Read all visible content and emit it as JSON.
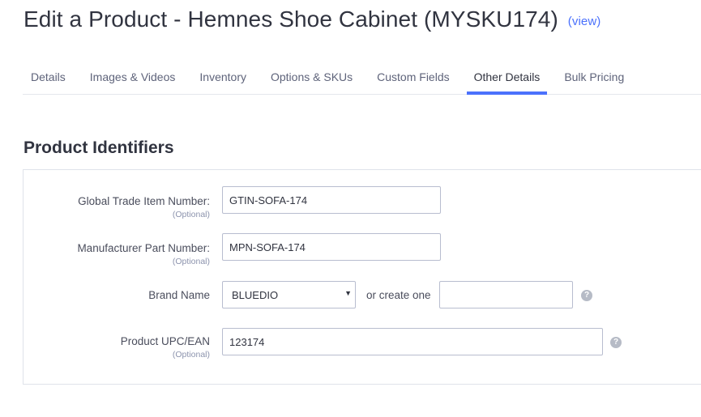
{
  "header": {
    "title": "Edit a Product - Hemnes Shoe Cabinet (MYSKU174)",
    "view_link": "(view)"
  },
  "tabs": [
    {
      "label": "Details",
      "active": false
    },
    {
      "label": "Images & Videos",
      "active": false
    },
    {
      "label": "Inventory",
      "active": false
    },
    {
      "label": "Options & SKUs",
      "active": false
    },
    {
      "label": "Custom Fields",
      "active": false
    },
    {
      "label": "Other Details",
      "active": true
    },
    {
      "label": "Bulk Pricing",
      "active": false
    }
  ],
  "section": {
    "title": "Product Identifiers"
  },
  "form": {
    "gtin": {
      "label": "Global Trade Item Number:",
      "optional": "(Optional)",
      "value": "GTIN-SOFA-174"
    },
    "mpn": {
      "label": "Manufacturer Part Number:",
      "optional": "(Optional)",
      "value": "MPN-SOFA-174"
    },
    "brand": {
      "label": "Brand Name",
      "selected": "BLUEDIO",
      "or_create": "or create one",
      "new_value": ""
    },
    "upc": {
      "label": "Product UPC/EAN",
      "optional": "(Optional)",
      "value": "123174"
    }
  },
  "icons": {
    "help": "question-mark-icon",
    "dropdown": "caret-down-icon"
  },
  "colors": {
    "accent": "#4b71fc",
    "text": "#313440",
    "border": "#dfe3ea"
  }
}
